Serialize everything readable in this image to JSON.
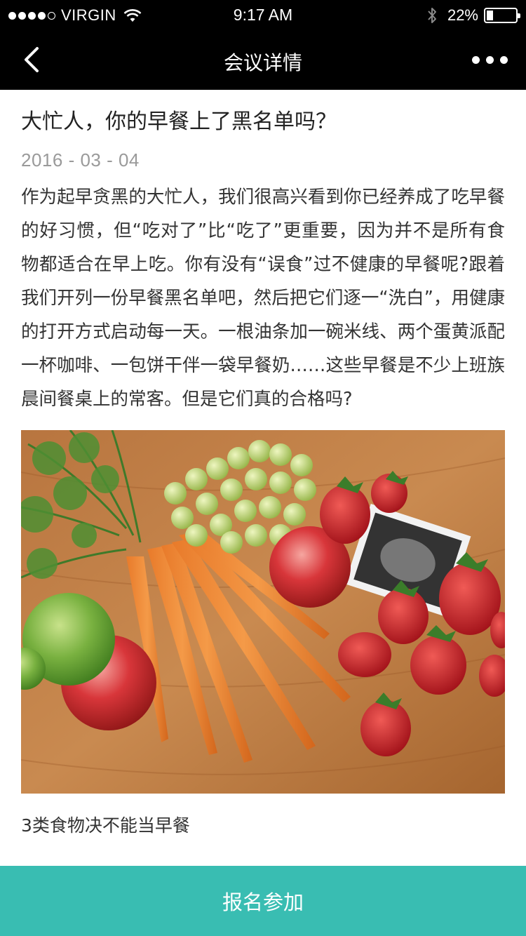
{
  "status_bar": {
    "carrier": "VIRGIN",
    "time": "9:17 AM",
    "battery_percent": "22%",
    "battery_level": 0.22,
    "signal_bars": 4,
    "signal_total": 5,
    "icons": [
      "signal-dots-icon",
      "wifi-icon",
      "bluetooth-icon",
      "battery-icon"
    ]
  },
  "nav": {
    "title": "会议详情",
    "back_icon": "chevron-left-icon",
    "more_icon": "more-dots-icon"
  },
  "article": {
    "title": "大忙人，你的早餐上了黑名单吗？",
    "date": "2016 - 03 - 04",
    "body": "作为起早贪黑的大忙人，我们很高兴看到你已经养成了吃早餐的好习惯，但“吃对了”比“吃了”更重要，因为并不是所有食物都适合在早上吃。你有没有“误食”过不健康的早餐呢?跟着我们开列一份早餐黑名单吧，然后把它们逐一“洗白”，用健康的打开方式启动每一天。一根油条加一碗米线、两个蛋黄派配一杯咖啡、一包饼干伴一袋早餐奶……这些早餐是不少上班族晨间餐桌上的常客。但是它们真的合格吗?",
    "image_subject": "fruits-and-vegetables-photo",
    "caption": "3类食物决不能当早餐"
  },
  "footer": {
    "button_label": "报名参加"
  },
  "colors": {
    "bar_background": "#000000",
    "accent": "#39bdb2",
    "date_text": "#9a9a9a",
    "body_text": "#333333"
  }
}
